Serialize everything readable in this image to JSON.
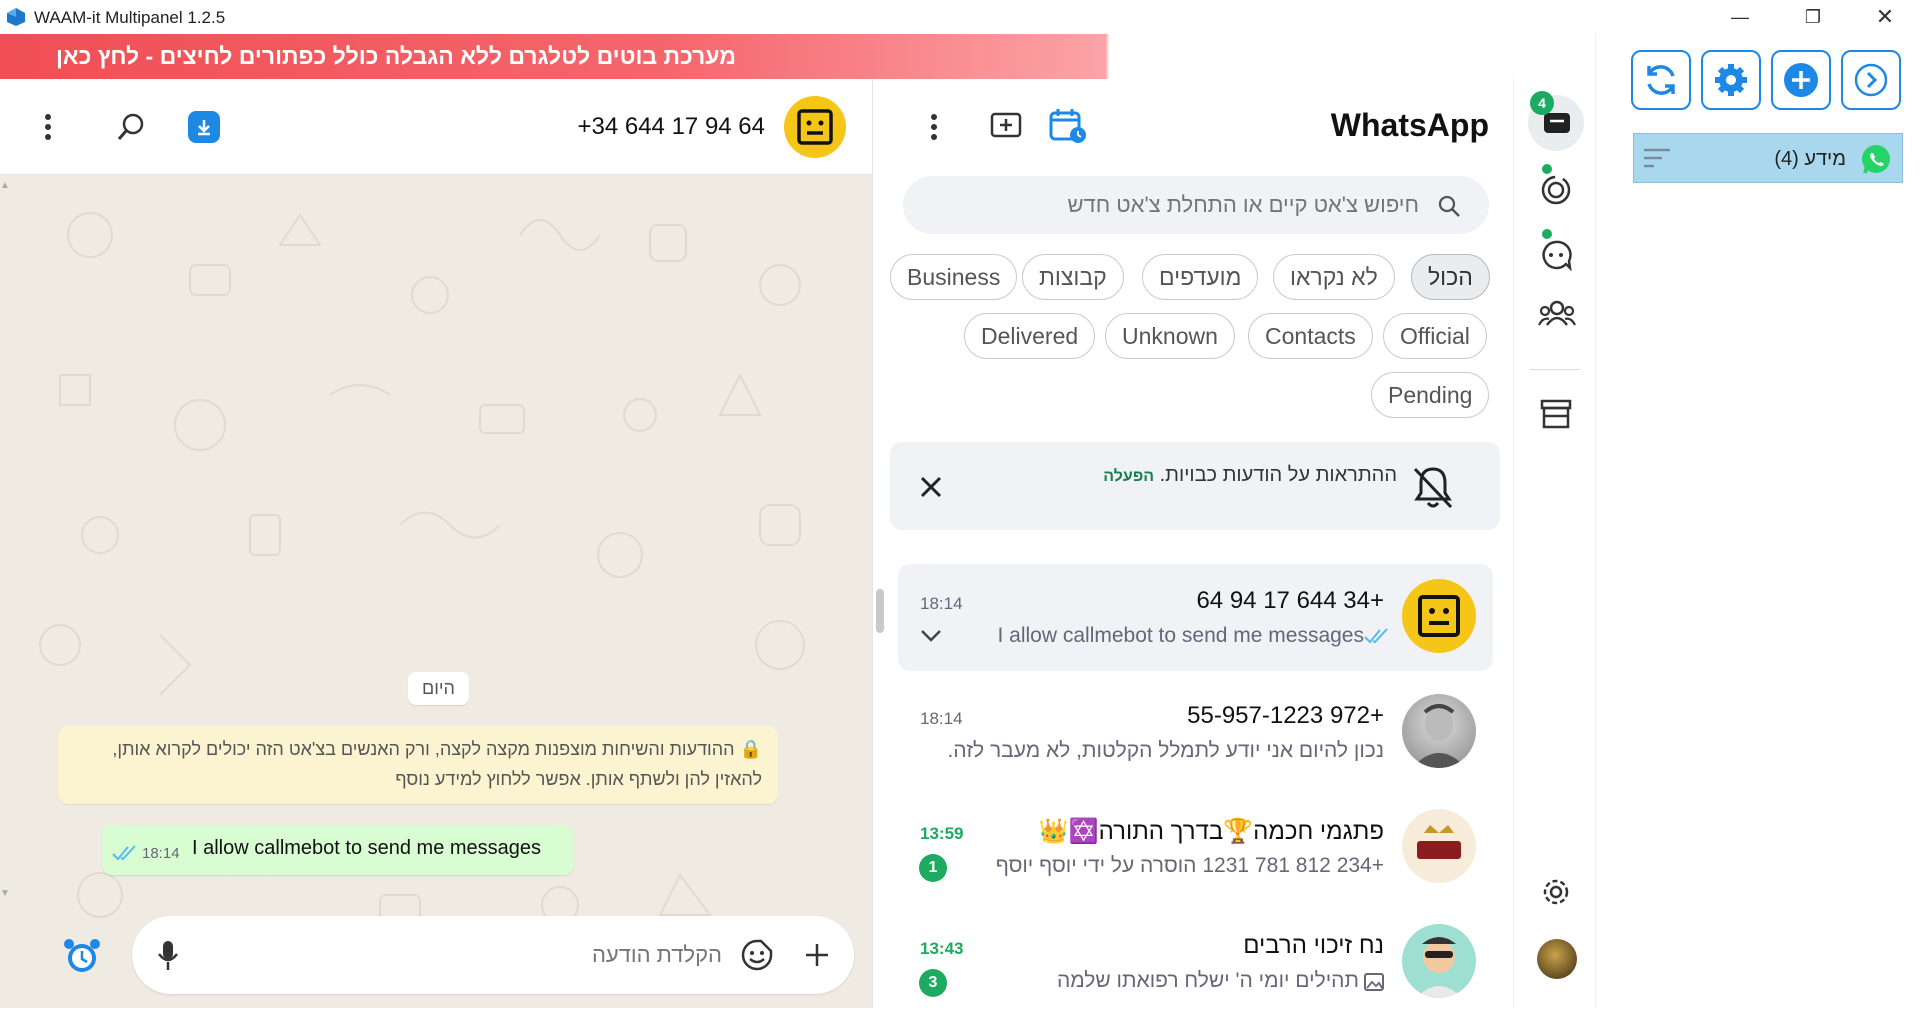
{
  "window": {
    "title": "WAAM-it Multipanel 1.2.5"
  },
  "banner": {
    "text": "מערכת בוטים לטלגרם ללא הגבלה כולל כפתורים לחיצים - ",
    "cta": "לחץ כאן"
  },
  "chat": {
    "contact_name": "+34 644 17 94 64",
    "date_chip": "היום",
    "encryption_notice": "ההודעות והשיחות מוצפנות מקצה לקצה, ורק האנשים בצ'אט הזה יכולים לקרוא אותן, להאזין להן ולשתף אותן. אפשר ללחוץ למידע נוסף",
    "message": {
      "text": "I allow callmebot to send me messages",
      "time": "18:14"
    },
    "input_placeholder": "הקלדת הודעה"
  },
  "list": {
    "app_title": "WhatsApp",
    "search_placeholder": "חיפוש צ'אט קיים או התחלת צ'אט חדש",
    "filters_row1": [
      "הכול",
      "לא נקראו",
      "מועדפים",
      "קבוצות",
      "Business"
    ],
    "filters_row2": [
      "Official",
      "Contacts",
      "Unknown",
      "Delivered"
    ],
    "filters_row3": [
      "Pending"
    ],
    "notice": {
      "text": "ההתראות על הודעות כבויות.",
      "action": "הפעלה"
    },
    "chats": [
      {
        "name": "+34 644 17 94 64",
        "preview": "I allow callmebot to send me messages",
        "time": "18:14",
        "badge": ""
      },
      {
        "name": "+972 55-957-1223",
        "preview": "נכון להיום אני יודע לתמלל הקלטות, לא מעבר לזה.",
        "time": "18:14",
        "badge": ""
      },
      {
        "name": "פתגמי חכמה🏆בדרך התורה✡️👑",
        "preview": "+234 812 781 1231 הוסרה על ידי יוסף יוסף",
        "time": "13:59",
        "badge": "1"
      },
      {
        "name": "נח זיכוי הרבים",
        "preview": "תהילים יומי ה' ישלח רפואתו שלמה",
        "time": "13:43",
        "badge": "3"
      }
    ]
  },
  "nav": {
    "chats_badge": "4"
  },
  "right": {
    "account_label": "מידע (4)"
  },
  "colors": {
    "green": "#1daa61",
    "blue": "#1e88e5",
    "banner": "#ef4f55"
  }
}
